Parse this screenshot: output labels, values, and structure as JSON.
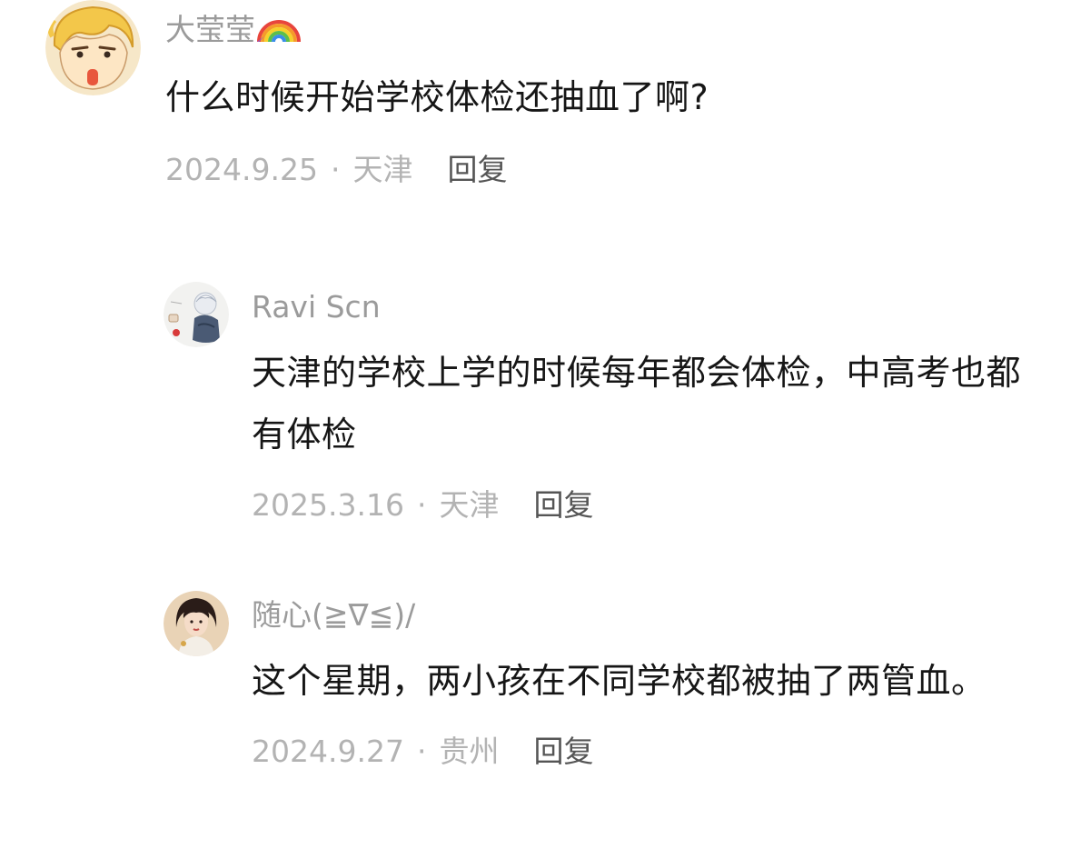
{
  "comments": [
    {
      "username": "大莹莹",
      "username_badge_icon": "rainbow-icon",
      "avatar_icon": "cartoon-avatar-icon",
      "content": "什么时候开始学校体检还抽血了啊?",
      "date": "2024.9.25",
      "separator": "·",
      "location": "天津",
      "reply_label": "回复"
    },
    {
      "username": "Ravi Scn",
      "avatar_icon": "anime-boy-avatar-icon",
      "content": "天津的学校上学的时候每年都会体检，中高考也都有体检",
      "date": "2025.3.16",
      "separator": "·",
      "location": "天津",
      "reply_label": "回复"
    },
    {
      "username": "随心(≧∇≦)/",
      "avatar_icon": "portrait-avatar-icon",
      "content": "这个星期，两小孩在不同学校都被抽了两管血。",
      "date": "2024.9.27",
      "separator": "·",
      "location": "贵州",
      "reply_label": "回复"
    }
  ],
  "colors": {
    "username": "#9b9b9b",
    "content": "#161616",
    "meta": "#b3b3b3",
    "reply": "#555555"
  }
}
